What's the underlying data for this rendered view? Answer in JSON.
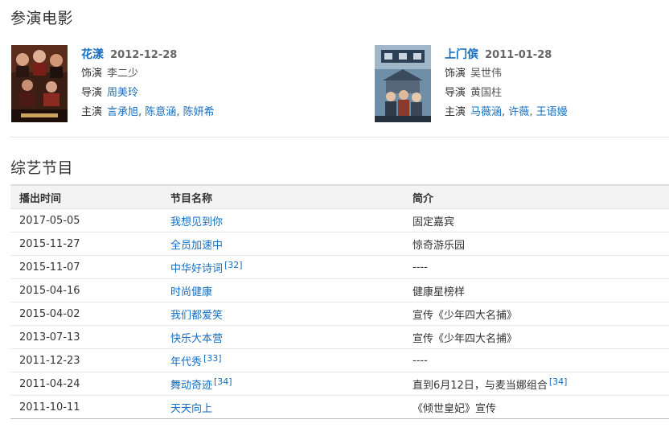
{
  "films_section": {
    "title": "参演电影",
    "films": [
      {
        "name": "花漾",
        "date": "2012-12-28",
        "role_label": "饰演",
        "role": "李二少",
        "director_label": "导演",
        "director": "周美玲",
        "cast_label": "主演",
        "cast": [
          "言承旭",
          "陈意涵",
          "陈妍希"
        ]
      },
      {
        "name": "上门傧",
        "date": "2011-01-28",
        "role_label": "饰演",
        "role": "吴世伟",
        "director_label": "导演",
        "director": "黄国柱",
        "cast_label": "主演",
        "cast": [
          "马薇涵",
          "许薇",
          "王语嫚"
        ]
      }
    ]
  },
  "variety_section": {
    "title": "综艺节目",
    "headers": [
      "播出时间",
      "节目名称",
      "简介"
    ],
    "rows": [
      {
        "date": "2017-05-05",
        "name": "我想见到你",
        "ref": "",
        "desc": "固定嘉宾",
        "desc_ref": ""
      },
      {
        "date": "2015-11-27",
        "name": "全员加速中",
        "ref": "",
        "desc": "惊奇游乐园",
        "desc_ref": ""
      },
      {
        "date": "2015-11-07",
        "name": "中华好诗词",
        "ref": "[32]",
        "desc": "----",
        "desc_ref": ""
      },
      {
        "date": "2015-04-16",
        "name": "时尚健康",
        "ref": "",
        "desc": "健康星榜样",
        "desc_ref": ""
      },
      {
        "date": "2015-04-02",
        "name": "我们都爱笑",
        "ref": "",
        "desc": "宣传《少年四大名捕》",
        "desc_ref": ""
      },
      {
        "date": "2013-07-13",
        "name": "快乐大本营",
        "ref": "",
        "desc": "宣传《少年四大名捕》",
        "desc_ref": ""
      },
      {
        "date": "2011-12-23",
        "name": "年代秀",
        "ref": "[33]",
        "desc": "----",
        "desc_ref": ""
      },
      {
        "date": "2011-04-24",
        "name": "舞动奇迹",
        "ref": "[34]",
        "desc": "直到6月12日，与麦当娜组合",
        "desc_ref": "[34]"
      },
      {
        "date": "2011-10-11",
        "name": "天天向上",
        "ref": "",
        "desc": "《倾世皇妃》宣传",
        "desc_ref": ""
      }
    ]
  },
  "colors": {
    "link": "#136ec2",
    "header_bg": "#f3f3f3",
    "text": "#333333"
  }
}
